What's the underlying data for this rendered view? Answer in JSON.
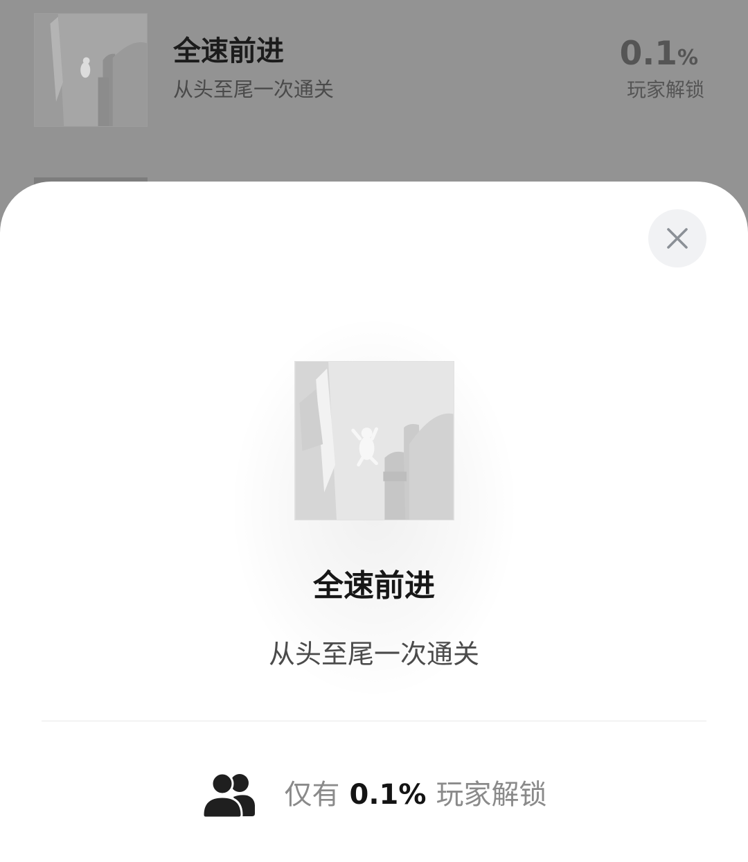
{
  "background_item": {
    "title": "全速前进",
    "subtitle": "从头至尾一次通关",
    "percent_value": "0.1",
    "percent_symbol": "%",
    "percent_label": "玩家解锁"
  },
  "sheet": {
    "title": "全速前进",
    "description": "从头至尾一次通关",
    "stat_prefix": "仅有",
    "stat_value": "0.1%",
    "stat_suffix": "玩家解锁",
    "icons": {
      "close": "close-icon",
      "players": "users-icon"
    }
  },
  "colors": {
    "scrim": "#939393",
    "sheet": "#ffffff",
    "close_bg": "#f1f2f4"
  }
}
